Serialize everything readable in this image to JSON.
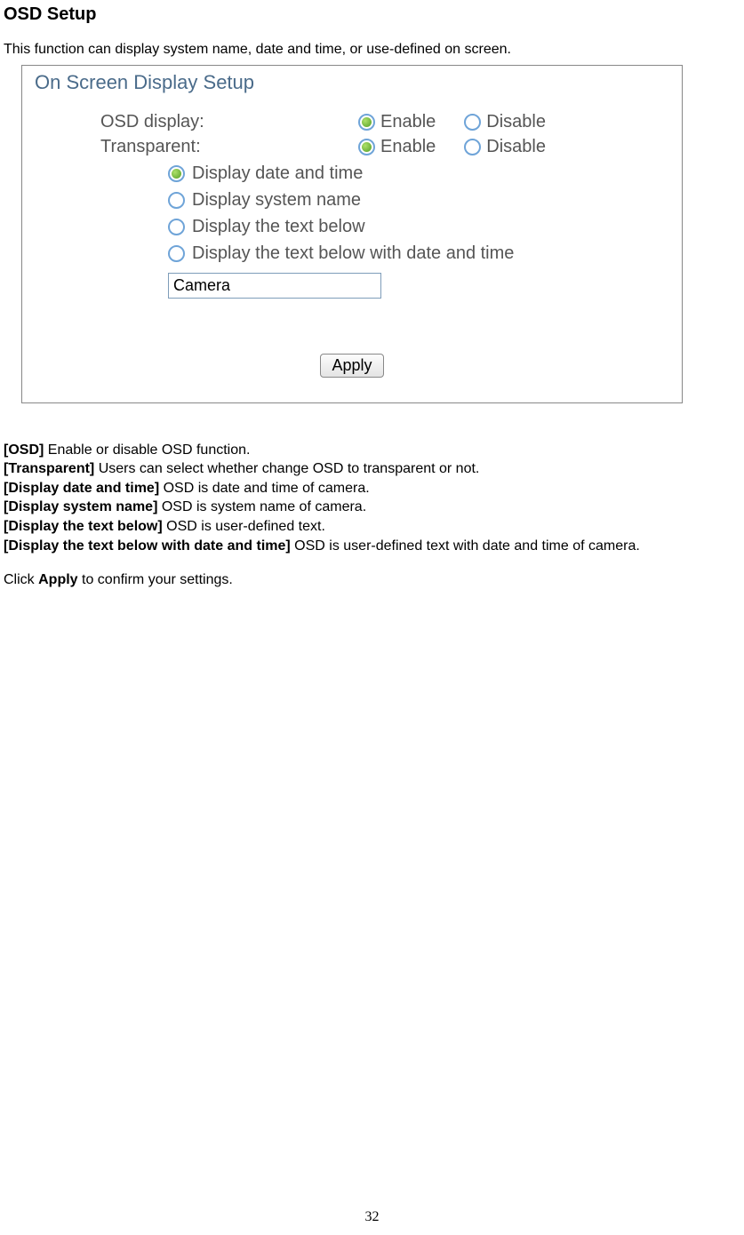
{
  "heading": "OSD Setup",
  "intro": "This function can display system name, date and time, or use-defined on screen.",
  "panel": {
    "title": "On Screen Display Setup",
    "rows": [
      {
        "label": "OSD display:",
        "enable": "Enable",
        "disable": "Disable",
        "selected": "enable"
      },
      {
        "label": "Transparent:",
        "enable": "Enable",
        "disable": "Disable",
        "selected": "enable"
      }
    ],
    "options": [
      {
        "label": "Display date and time",
        "selected": true
      },
      {
        "label": "Display system name",
        "selected": false
      },
      {
        "label": "Display the text below",
        "selected": false
      },
      {
        "label": "Display the text below with date and time",
        "selected": false
      }
    ],
    "custom_text_value": "Camera",
    "apply_label": "Apply"
  },
  "definitions": [
    {
      "key": "[OSD]",
      "text": " Enable or disable OSD function."
    },
    {
      "key": "[Transparent]",
      "text": " Users can select whether change OSD to transparent or not."
    },
    {
      "key": "[Display date and time]",
      "text": " OSD is date and time of camera."
    },
    {
      "key": "[Display system name]",
      "text": " OSD is system name of camera."
    },
    {
      "key": "[Display the text below]",
      "text": " OSD is user-defined text."
    },
    {
      "key": "[Display the text below with date and time]",
      "text": " OSD is user-defined text with date and time of camera."
    }
  ],
  "closing_pre": "Click ",
  "closing_bold": "Apply",
  "closing_post": " to confirm your settings.",
  "page_number": "32"
}
